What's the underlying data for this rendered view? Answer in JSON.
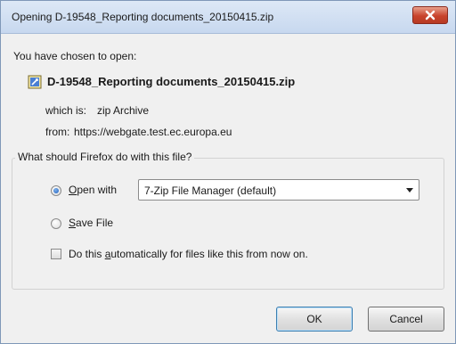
{
  "window": {
    "title": "Opening D-19548_Reporting documents_20150415.zip"
  },
  "dialog": {
    "intro": "You have chosen to open:",
    "file_name": "D-19548_Reporting documents_20150415.zip",
    "which_is_label": "which is:",
    "which_is_value": "zip Archive",
    "from_label": "from:",
    "from_value": "https://webgate.test.ec.europa.eu",
    "group_title": "What should Firefox do with this file?",
    "open_with": {
      "label_hotkey": "O",
      "label_rest": "pen with",
      "selected": true,
      "app": "7-Zip File Manager (default)"
    },
    "save_file": {
      "label_hotkey": "S",
      "label_rest": "ave File",
      "selected": false
    },
    "auto_checkbox": {
      "label_pre": "Do this ",
      "label_hotkey": "a",
      "label_rest": "utomatically for files like this from now on.",
      "checked": false
    },
    "ok_label": "OK",
    "cancel_label": "Cancel"
  },
  "icons": {
    "close": "close-icon",
    "file": "zip-file-icon",
    "dropdown": "chevron-down-icon"
  },
  "colors": {
    "title_bar": "#c7d8ef",
    "close_button": "#c8432c",
    "radio_selected": "#1f5fbf",
    "default_button_border": "#3c7fb1"
  }
}
